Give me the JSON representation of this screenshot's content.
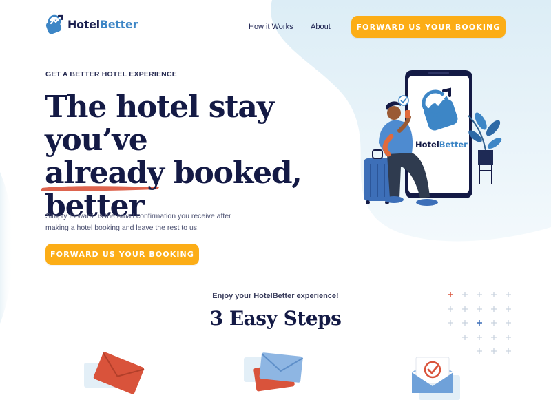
{
  "header": {
    "logo": {
      "name_part1": "Hotel",
      "name_part2": "Better"
    },
    "nav": [
      {
        "label": "How it Works"
      },
      {
        "label": "About"
      }
    ],
    "cta_label": "FORWARD US YOUR BOOKING"
  },
  "hero": {
    "eyebrow": "GET A BETTER HOTEL EXPERIENCE",
    "headline_lines": [
      "The hotel stay you’ve",
      "already booked,",
      "better"
    ],
    "subtext_lines": [
      "Simply forward us the email confirmation you receive after",
      "making a hotel booking and leave the rest to us."
    ],
    "cta_label": "FORWARD US YOUR BOOKING",
    "phone_brand": {
      "part1": "Hotel",
      "part2": "Better"
    }
  },
  "steps": {
    "kicker": "Enjoy your HotelBetter experience!",
    "title": "3 Easy Steps",
    "icons": [
      "envelope-icon",
      "envelopes-icon",
      "envelope-check-icon"
    ]
  },
  "colors": {
    "navy": "#141a45",
    "accent_orange": "#fcad16",
    "brand_blue": "#3d86c6",
    "underline_red": "#d9533b",
    "bg_blue": "#e4f1f8"
  }
}
